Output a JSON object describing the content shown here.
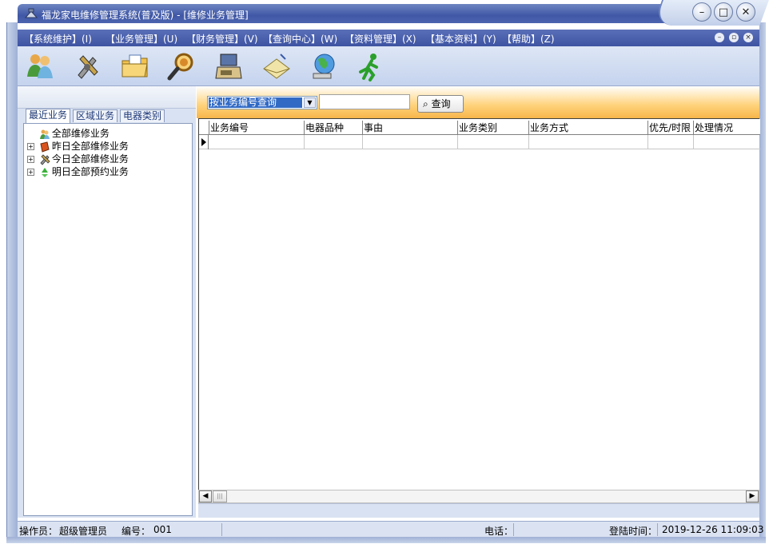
{
  "window": {
    "title": "福龙家电维修管理系统(普及版) - [维修业务管理]",
    "controls": [
      "minimize-icon",
      "maximize-icon",
      "close-icon"
    ]
  },
  "menu": {
    "items": [
      "【系统维护】(I)",
      "【业务管理】(U)",
      "【财务管理】(V)",
      "【查询中心】(W)",
      "【资料管理】(X)",
      "【基本资料】(Y)",
      "【帮助】(Z)"
    ]
  },
  "toolbar": {
    "icons": [
      "users-icon",
      "tools-icon",
      "folder-icon",
      "magnifier-icon",
      "fax-icon",
      "mail-icon",
      "globe-icon",
      "running-man-icon"
    ]
  },
  "left_tabs": [
    "最近业务",
    "区域业务",
    "电器类别"
  ],
  "tree": {
    "items": [
      {
        "label": "全部维修业务",
        "icon": "users-icon",
        "expandable": false
      },
      {
        "label": "昨日全部维修业务",
        "icon": "book-icon",
        "expandable": true
      },
      {
        "label": "今日全部维修业务",
        "icon": "tools-icon",
        "expandable": true
      },
      {
        "label": "明日全部预约业务",
        "icon": "recycle-icon",
        "expandable": true
      }
    ]
  },
  "search": {
    "mode_selected": "按业务编号查询",
    "input_value": "",
    "query_button": "查询"
  },
  "grid": {
    "columns": [
      "业务编号",
      "电器品种",
      "事由",
      "业务类别",
      "业务方式",
      "优先/时限",
      "处理情况"
    ],
    "rows": []
  },
  "status": {
    "operator_label": "操作员：",
    "operator": "超级管理员",
    "id_label": "编号：",
    "id": "001",
    "phone_label": "电话：",
    "phone": "",
    "login_label": "登陆时间：",
    "login_time": "2019-12-26 11:09:03"
  }
}
